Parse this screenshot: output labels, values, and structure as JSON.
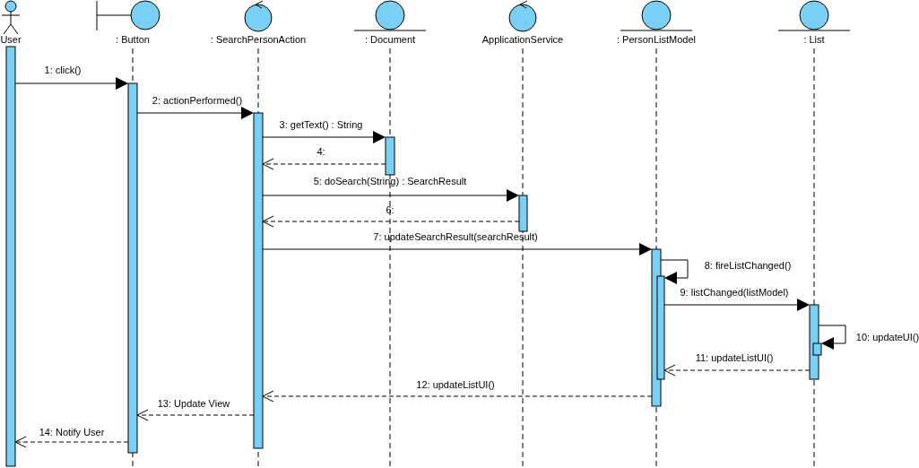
{
  "lifelines": [
    {
      "name": "User",
      "kind": "actor"
    },
    {
      "name": ": Button",
      "kind": "boundary"
    },
    {
      "name": ": SearchPersonAction",
      "kind": "control"
    },
    {
      "name": ": Document",
      "kind": "entity"
    },
    {
      "name": "ApplicationService",
      "kind": "control"
    },
    {
      "name": ": PersonListModel",
      "kind": "entity"
    },
    {
      "name": ": List",
      "kind": "entity"
    }
  ],
  "messages": [
    {
      "label": "1: click()",
      "kind": "call"
    },
    {
      "label": "2: actionPerformed()",
      "kind": "call"
    },
    {
      "label": "3: getText() : String",
      "kind": "call"
    },
    {
      "label": "4:",
      "kind": "return"
    },
    {
      "label": "5: doSearch(String) : SearchResult",
      "kind": "call"
    },
    {
      "label": "6:",
      "kind": "return"
    },
    {
      "label": "7: updateSearchResult(searchResult)",
      "kind": "call"
    },
    {
      "label": "8: fireListChanged()",
      "kind": "self"
    },
    {
      "label": "9: listChanged(listModel)",
      "kind": "call"
    },
    {
      "label": "10: updateUI()",
      "kind": "self"
    },
    {
      "label": "11: updateListUI()",
      "kind": "return"
    },
    {
      "label": "12: updateListUI()",
      "kind": "return"
    },
    {
      "label": "13: Update View",
      "kind": "return"
    },
    {
      "label": "14: Notify User",
      "kind": "return"
    }
  ]
}
